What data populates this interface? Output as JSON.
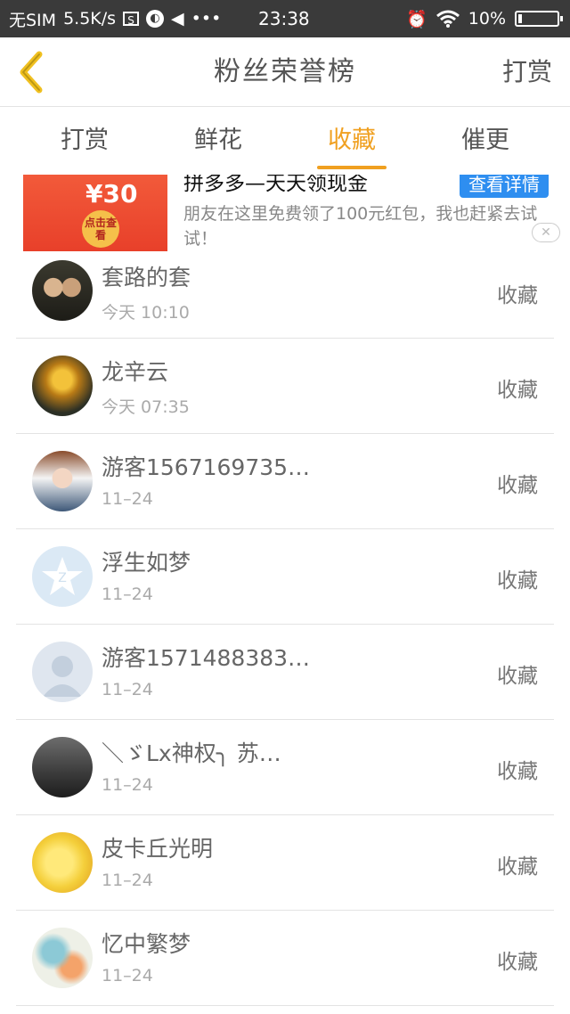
{
  "status_bar": {
    "carrier": "无SIM",
    "net_speed": "5.5K/s",
    "time": "23:38",
    "battery": "10%",
    "battery_level": 0.1
  },
  "header": {
    "title": "粉丝荣誉榜",
    "right_button": "打赏"
  },
  "tabs": [
    {
      "label": "打赏",
      "active": false
    },
    {
      "label": "鲜花",
      "active": false
    },
    {
      "label": "收藏",
      "active": true
    },
    {
      "label": "催更",
      "active": false
    }
  ],
  "ad": {
    "amount": "¥30",
    "sticker": "点击查看",
    "title": "拼多多—天天领现金",
    "detail_button": "查看详情",
    "description": "朋友在这里免费领了100元红包，我也赶紧去试试！"
  },
  "list": [
    {
      "name": "套路的套",
      "time": "今天 10:10",
      "action": "收藏"
    },
    {
      "name": "龙辛云",
      "time": "今天 07:35",
      "action": "收藏"
    },
    {
      "name": "游客1567169735…",
      "time": "11–24",
      "action": "收藏"
    },
    {
      "name": "浮生如梦",
      "time": "11–24",
      "action": "收藏"
    },
    {
      "name": "游客1571488383…",
      "time": "11–24",
      "action": "收藏"
    },
    {
      "name": "＼ゞLx神权╮ 苏…",
      "time": "11–24",
      "action": "收藏"
    },
    {
      "name": "皮卡丘光明",
      "time": "11–24",
      "action": "收藏"
    },
    {
      "name": "忆中繁梦",
      "time": "11–24",
      "action": "收藏"
    }
  ],
  "colors": {
    "accent": "#f0a020",
    "status_bar": "#3a3a3a",
    "ad_red": "#e8402a",
    "ad_button": "#2e8ef0"
  }
}
